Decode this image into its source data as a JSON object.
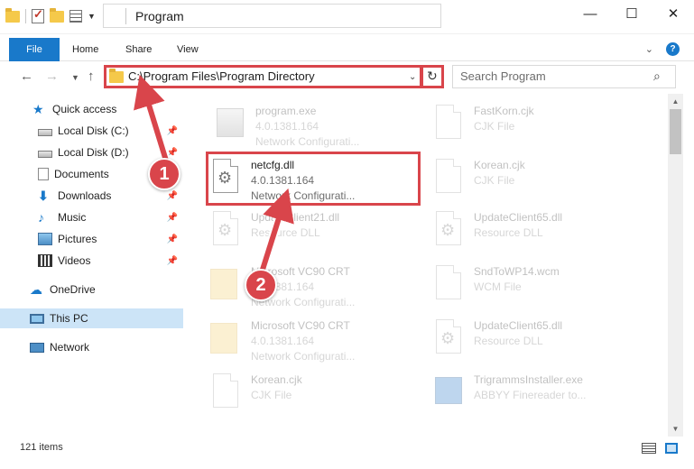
{
  "window": {
    "title": "Program",
    "minimize": "—",
    "maximize": "☐",
    "close": "✕"
  },
  "ribbon": {
    "tabs": [
      "File",
      "Home",
      "Share",
      "View"
    ],
    "help": "?"
  },
  "navigation": {
    "address": "C:\\Program Files\\Program Directory",
    "search_placeholder": "Search Program"
  },
  "sidebar": {
    "items": [
      {
        "label": "Quick access",
        "icon": "star-icon"
      },
      {
        "label": "Local Disk (C:)",
        "icon": "disk-icon",
        "pinned": true
      },
      {
        "label": "Local Disk (D:)",
        "icon": "disk-icon",
        "pinned": true
      },
      {
        "label": "Documents",
        "icon": "documents-icon",
        "pinned": true
      },
      {
        "label": "Downloads",
        "icon": "download-icon",
        "pinned": true
      },
      {
        "label": "Music",
        "icon": "music-icon",
        "pinned": true
      },
      {
        "label": "Pictures",
        "icon": "pictures-icon",
        "pinned": true
      },
      {
        "label": "Videos",
        "icon": "videos-icon",
        "pinned": true
      },
      {
        "label": "OneDrive",
        "icon": "cloud-icon"
      },
      {
        "label": "This PC",
        "icon": "computer-icon",
        "selected": true
      },
      {
        "label": "Network",
        "icon": "network-icon"
      }
    ]
  },
  "files": [
    {
      "name": "program.exe",
      "version": "4.0.1381.164",
      "type": "Network Configurati...",
      "icon": "exe-icon"
    },
    {
      "name": "FastKorn.cjk",
      "version": "CJK File",
      "type": "",
      "icon": "document-icon"
    },
    {
      "name": "netcfg.dll",
      "version": "4.0.1381.164",
      "type": "Network Configurati...",
      "icon": "dll-icon"
    },
    {
      "name": "Korean.cjk",
      "version": "CJK File",
      "type": "",
      "icon": "document-icon"
    },
    {
      "name": "UpdateClient21.dll",
      "version": "Resource DLL",
      "type": "",
      "icon": "dll-icon"
    },
    {
      "name": "UpdateClient65.dll",
      "version": "Resource DLL",
      "type": "",
      "icon": "dll-icon"
    },
    {
      "name": "Microsoft VC90 CRT",
      "version": "4.0.1381.164",
      "type": "Network Configurati...",
      "icon": "folder-icon"
    },
    {
      "name": "SndToWP14.wcm",
      "version": "WCM File",
      "type": "",
      "icon": "document-icon"
    },
    {
      "name": "Microsoft VC90 CRT",
      "version": "4.0.1381.164",
      "type": "Network Configurati...",
      "icon": "folder-icon"
    },
    {
      "name": "UpdateClient65.dll",
      "version": "Resource DLL",
      "type": "",
      "icon": "dll-icon"
    },
    {
      "name": "Korean.cjk",
      "version": "CJK File",
      "type": "",
      "icon": "document-icon"
    },
    {
      "name": "TrigrammsInstaller.exe",
      "version": "ABBYY Finereader to...",
      "type": "",
      "icon": "installer-icon"
    }
  ],
  "status": {
    "item_count": "121 items"
  },
  "annotations": {
    "step1": "1",
    "step2": "2"
  },
  "colors": {
    "accent": "#1979ca",
    "highlight": "#d9454b",
    "selected_bg": "#cce4f7"
  }
}
